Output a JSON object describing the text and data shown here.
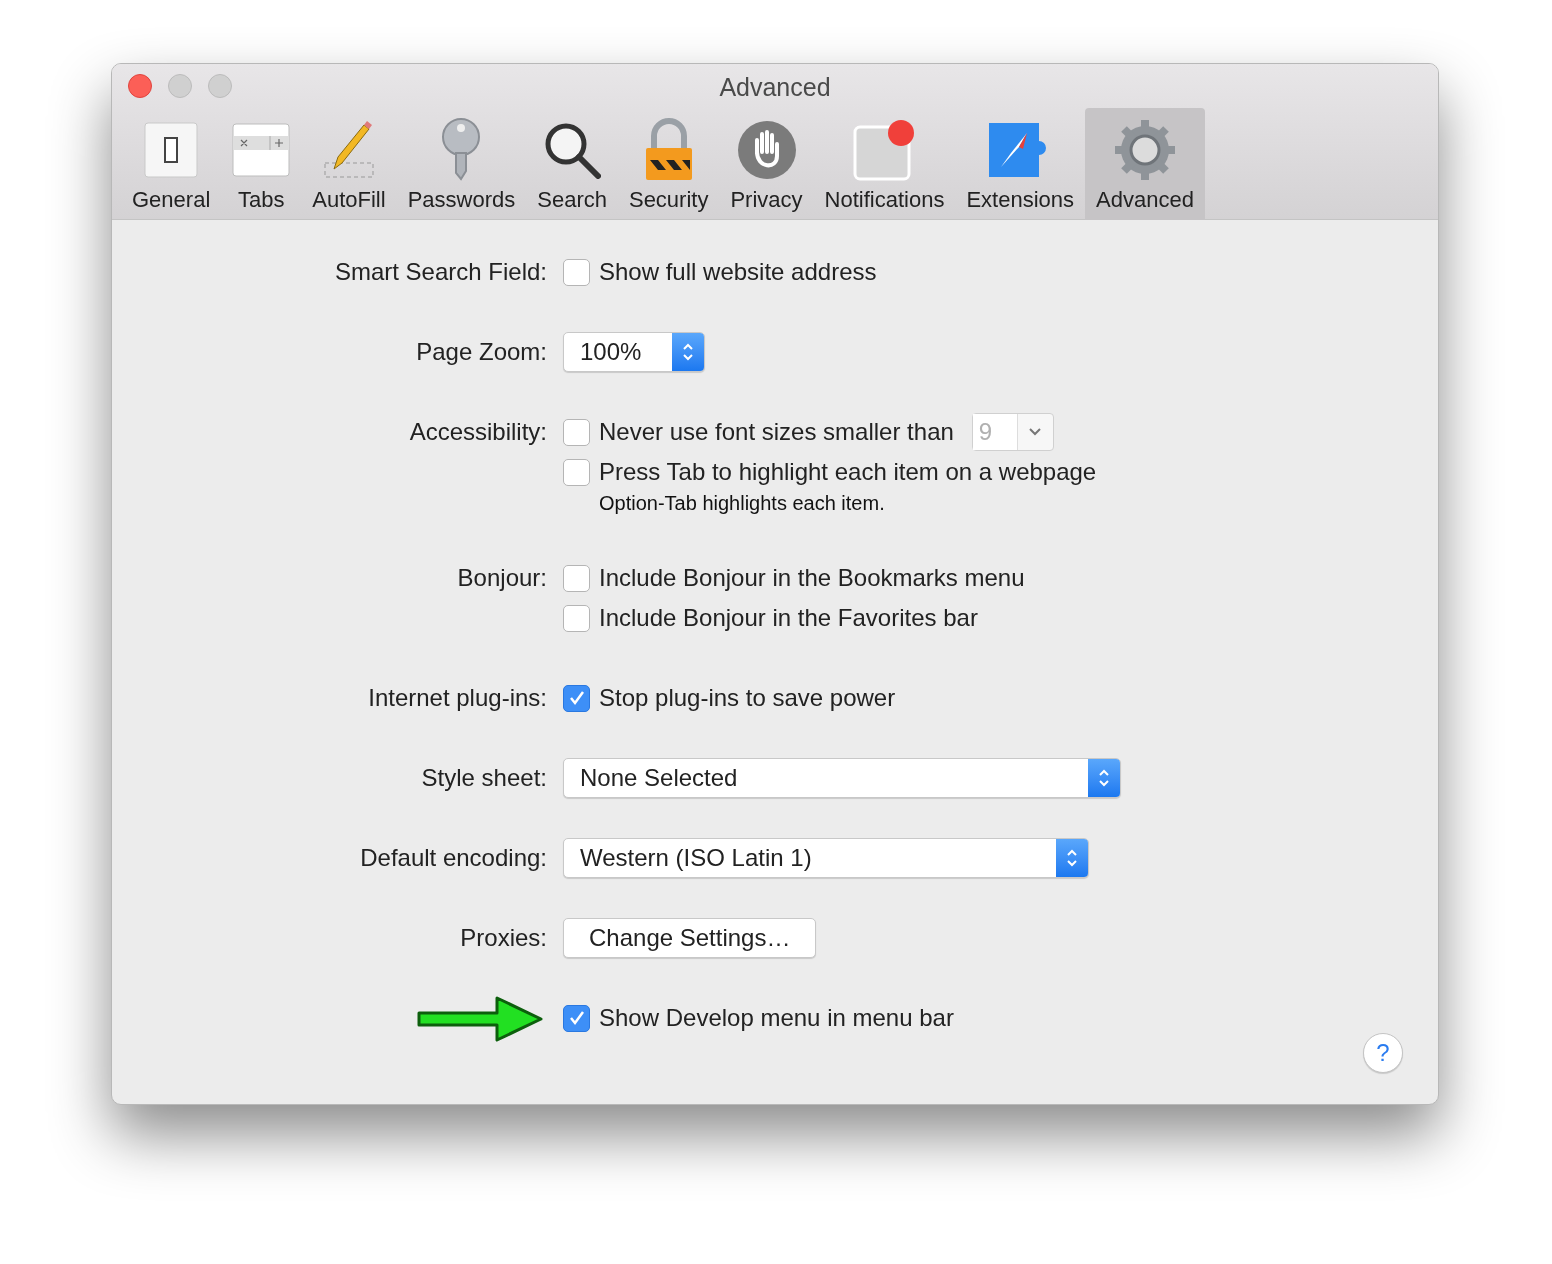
{
  "window": {
    "title": "Advanced"
  },
  "toolbar": [
    {
      "label": "General",
      "kind": "general",
      "selected": false
    },
    {
      "label": "Tabs",
      "kind": "tabs",
      "selected": false
    },
    {
      "label": "AutoFill",
      "kind": "autofill",
      "selected": false
    },
    {
      "label": "Passwords",
      "kind": "passwords",
      "selected": false
    },
    {
      "label": "Search",
      "kind": "search",
      "selected": false
    },
    {
      "label": "Security",
      "kind": "security",
      "selected": false
    },
    {
      "label": "Privacy",
      "kind": "privacy",
      "selected": false
    },
    {
      "label": "Notifications",
      "kind": "notifications",
      "selected": false
    },
    {
      "label": "Extensions",
      "kind": "extensions",
      "selected": false
    },
    {
      "label": "Advanced",
      "kind": "advanced",
      "selected": true
    }
  ],
  "settings": [
    {
      "label": "Smart Search Field:",
      "controls": [
        {
          "kind": "checkbox",
          "text": "Show full website address",
          "checked": false
        }
      ]
    },
    {
      "label": "Page Zoom:",
      "controls": [
        {
          "kind": "popup",
          "value": "100%"
        }
      ]
    },
    {
      "label": "Accessibility:",
      "controls": [
        {
          "kind": "checkbox",
          "text": "Never use font sizes smaller than",
          "checked": false,
          "combo": {
            "value": "9",
            "disabled": true
          }
        },
        {
          "kind": "checkbox",
          "text": "Press Tab to highlight each item on a webpage",
          "checked": false
        },
        {
          "kind": "note",
          "text": "Option-Tab highlights each item."
        }
      ]
    },
    {
      "label": "Bonjour:",
      "controls": [
        {
          "kind": "checkbox",
          "text": "Include Bonjour in the Bookmarks menu",
          "checked": false
        },
        {
          "kind": "checkbox",
          "text": "Include Bonjour in the Favorites bar",
          "checked": false
        }
      ]
    },
    {
      "label": "Internet plug-ins:",
      "controls": [
        {
          "kind": "checkbox",
          "text": "Stop plug-ins to save power",
          "checked": true
        }
      ]
    },
    {
      "label": "Style sheet:",
      "controls": [
        {
          "kind": "popup",
          "value": "None Selected"
        }
      ]
    },
    {
      "label": "Default encoding:",
      "controls": [
        {
          "kind": "popup",
          "value": "Western (ISO Latin 1)"
        }
      ]
    },
    {
      "label": "Proxies:",
      "controls": [
        {
          "kind": "button",
          "text": "Change Settings…"
        }
      ]
    },
    {
      "pointer": true,
      "controls": [
        {
          "kind": "checkbox",
          "text": "Show Develop menu in menu bar",
          "checked": true
        }
      ]
    }
  ],
  "help_button": "?"
}
